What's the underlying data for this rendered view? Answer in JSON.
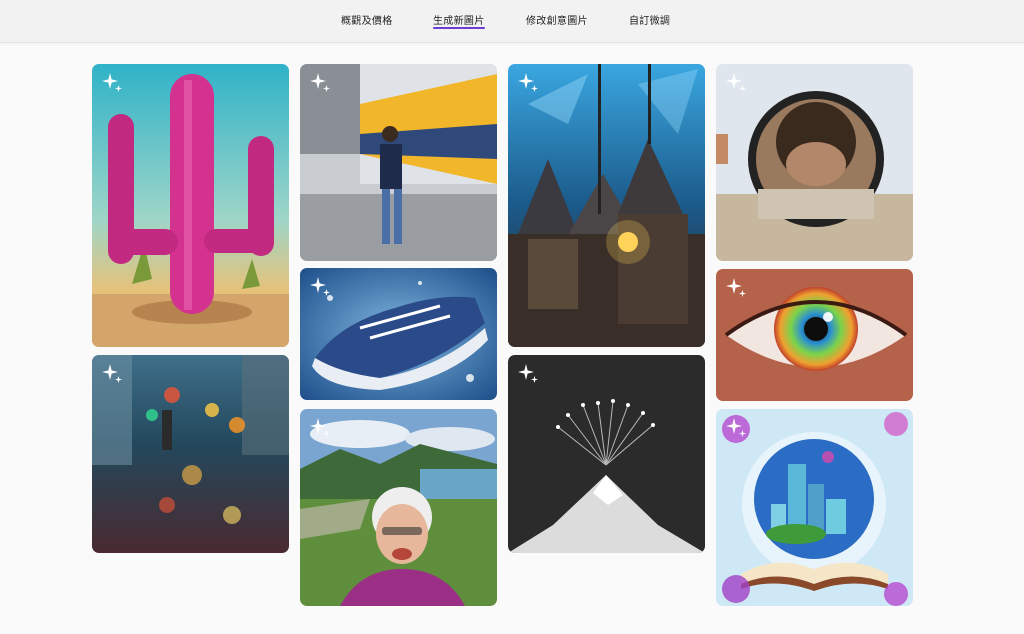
{
  "nav": {
    "tabs": [
      {
        "label": "概觀及價格",
        "active": false
      },
      {
        "label": "生成新圖片",
        "active": true
      },
      {
        "label": "修改創意圖片",
        "active": false
      },
      {
        "label": "自訂微調",
        "active": false
      }
    ],
    "accent_color": "#6b3fd6"
  },
  "gallery": {
    "badge_icon": "sparkle-icon",
    "images": [
      {
        "subject": "pink-cactus"
      },
      {
        "subject": "city-rain-reflection"
      },
      {
        "subject": "man-phone-tram"
      },
      {
        "subject": "running-shoe-splash"
      },
      {
        "subject": "grandma-selfie-lake"
      },
      {
        "subject": "cyber-castle"
      },
      {
        "subject": "snowy-mountain-dandelion"
      },
      {
        "subject": "magnifier-face"
      },
      {
        "subject": "colorful-eye"
      },
      {
        "subject": "book-city-flowers"
      }
    ]
  }
}
